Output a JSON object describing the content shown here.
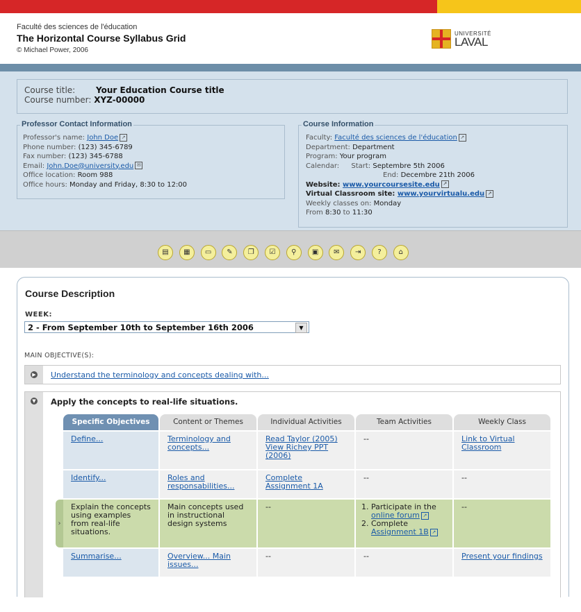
{
  "header": {
    "faculty": "Faculté des sciences de l'éducation",
    "title": "The Horizontal Course Syllabus Grid",
    "copyright": "© Michael Power, 2006",
    "logo_small": "UNIVERSITÉ",
    "logo_big": "LAVAL"
  },
  "course": {
    "title_label": "Course title:",
    "title_value": "Your Education Course title",
    "number_label": "Course number:",
    "number_value": "XYZ-00000"
  },
  "professor": {
    "legend": "Professor Contact Information",
    "name_label": "Professor's name:",
    "name_value": "John Doe",
    "phone_label": "Phone number:",
    "phone_value": "(123) 345-6789",
    "fax_label": "Fax number:",
    "fax_value": "(123) 345-6788",
    "email_label": "Email:",
    "email_value": "John.Doe@university.edu",
    "office_label": "Office location:",
    "office_value": "Room 988",
    "hours_label": "Office hours:",
    "hours_value": "Monday and Friday, 8:30 to 12:00"
  },
  "course_info": {
    "legend": "Course Information",
    "faculty_label": "Faculty:",
    "faculty_value": "Faculté des sciences de l'éducation",
    "department_label": "Department:",
    "department_value": "Department",
    "program_label": "Program:",
    "program_value": "Your program",
    "calendar_label": "Calendar:",
    "start_label": "Start:",
    "start_value": "Septembre 5th 2006",
    "end_label": "End:",
    "end_value": "Decembre 21th 2006",
    "website_label": "Website:",
    "website_value": "www.yourcoursesite.edu",
    "virtual_label": "Virtual Classroom site:",
    "virtual_value": "www.yourvirtualu.edu",
    "weekly_label": "Weekly classes on:",
    "weekly_value": "Monday",
    "from_label": "From",
    "from_value": "8:30",
    "to_label": "to",
    "to_value": "11:30"
  },
  "toolbar": {
    "icons": [
      "document-icon",
      "table-icon",
      "folder-icon",
      "edit-icon",
      "pages-icon",
      "checklist-icon",
      "search-icon",
      "presentation-icon",
      "chat-icon",
      "save-icon",
      "help-icon",
      "home-icon"
    ],
    "glyphs": [
      "▤",
      "▦",
      "▭",
      "✎",
      "❐",
      "☑",
      "⚲",
      "▣",
      "✉",
      "⇥",
      "?",
      "⌂"
    ]
  },
  "description": {
    "title": "Course Description",
    "week_label": "WEEK:",
    "week_selected": "2 - From September 10th to September 16th 2006",
    "objectives_label": "MAIN OBJECTIVE(S):",
    "objective1": "Understand the terminology and concepts dealing with...",
    "objective2": "Apply the concepts to real-life situations.",
    "tabs": [
      "Specific Objectives",
      "Content or Themes",
      "Individual Activities",
      "Team Activities",
      "Weekly Class"
    ],
    "rows": [
      [
        "Define...",
        "Terminology and concepts...",
        "Read Taylor (2005) View Richey PPT (2006)",
        "--",
        "Link to Virtual Classroom"
      ],
      [
        "Identify...",
        "Roles and responsabilities...",
        "Complete Assignment 1A",
        "--",
        "--"
      ],
      [
        "Explain the concepts using examples from real-life situations.",
        "Main concepts used in instructional design systems",
        "--",
        "",
        "--"
      ],
      [
        "Summarise...",
        "Overview... Main issues...",
        "--",
        "--",
        "Present your findings"
      ]
    ],
    "team_item1_a": "1. Participate in the",
    "team_item1_b": "online forum",
    "team_item2_a": "2. Complete",
    "team_item2_b": "Assignment 1B"
  }
}
